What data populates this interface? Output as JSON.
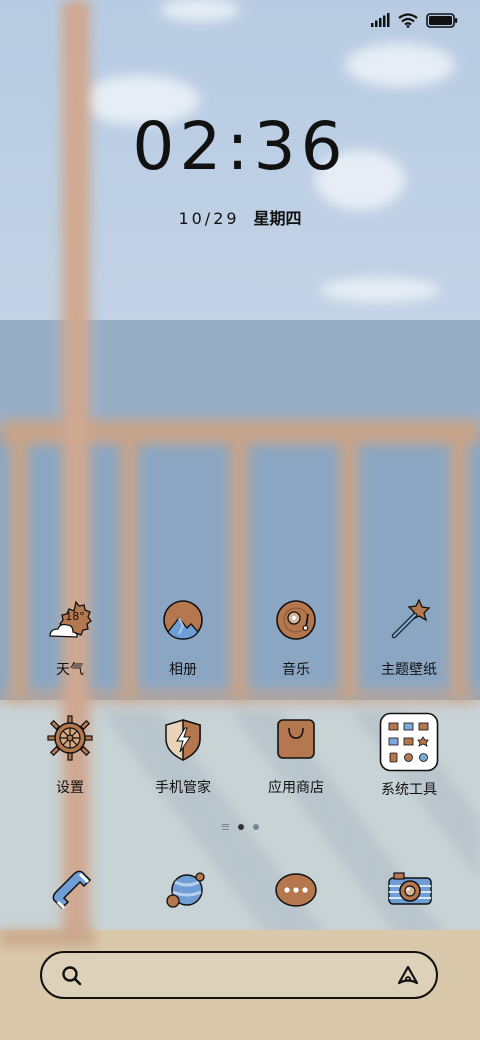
{
  "clock": {
    "time": "02:36",
    "date": "10/29",
    "weekday": "星期四"
  },
  "status_bar": {
    "signal": "signal-icon",
    "wifi": "wifi-icon",
    "battery": "battery-icon"
  },
  "weather_badge": "18°",
  "apps_row1": [
    {
      "label": "天气",
      "icon": "weather-icon"
    },
    {
      "label": "相册",
      "icon": "gallery-icon"
    },
    {
      "label": "音乐",
      "icon": "music-icon"
    },
    {
      "label": "主题壁纸",
      "icon": "themes-icon"
    }
  ],
  "apps_row2": [
    {
      "label": "设置",
      "icon": "settings-icon"
    },
    {
      "label": "手机管家",
      "icon": "security-icon"
    },
    {
      "label": "应用商店",
      "icon": "app-store-icon"
    },
    {
      "label": "系统工具",
      "icon": "system-tools-folder-icon"
    }
  ],
  "dock": [
    "phone-icon",
    "browser-icon",
    "messages-icon",
    "camera-icon"
  ],
  "search": {
    "left_icon": "search-icon",
    "right_icon": "assistant-icon"
  },
  "colors": {
    "accent": "#b5774e",
    "ink": "#111111",
    "sky": "#b8cde3",
    "ocean": "#8aa3bd"
  }
}
